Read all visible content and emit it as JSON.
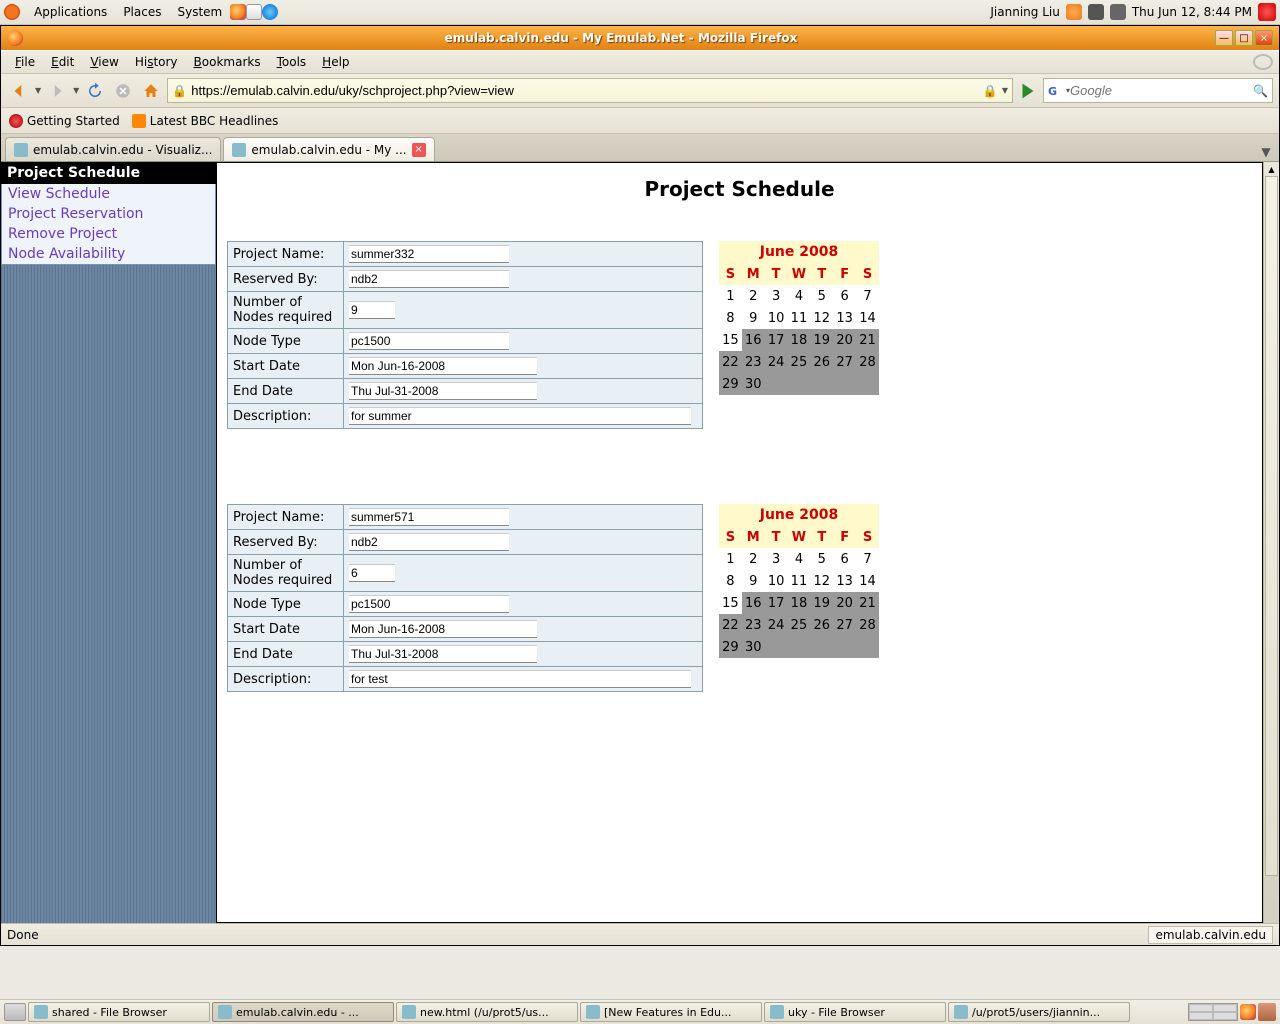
{
  "gnome": {
    "menus": {
      "applications": "Applications",
      "places": "Places",
      "system": "System"
    },
    "user": "Jianning Liu",
    "clock": "Thu Jun 12,  8:44 PM"
  },
  "firefox": {
    "title": "emulab.calvin.edu - My Emulab.Net - Mozilla Firefox",
    "menubar": {
      "file": "File",
      "edit": "Edit",
      "view": "View",
      "history": "History",
      "bookmarks": "Bookmarks",
      "tools": "Tools",
      "help": "Help"
    },
    "url": "https://emulab.calvin.edu/uky/schproject.php?view=view",
    "search_placeholder": "Google",
    "bookmarks": {
      "gs": "Getting Started",
      "bbc": "Latest BBC Headlines"
    },
    "tabs": {
      "t0": "emulab.calvin.edu - Visualiz...",
      "t1": "emulab.calvin.edu - My ..."
    },
    "status": "Done",
    "status_domain": "emulab.calvin.edu"
  },
  "sidebar": {
    "header": "Project Schedule",
    "items": {
      "view": "View Schedule",
      "res": "Project Reservation",
      "rem": "Remove Project",
      "avail": "Node Availability"
    }
  },
  "page": {
    "title": "Project Schedule",
    "labels": {
      "pname": "Project Name:",
      "rby": "Reserved By:",
      "nnodes": "Number of Nodes required",
      "ntype": "Node Type",
      "sdate": "Start Date",
      "edate": "End Date",
      "desc": "Description:"
    },
    "projects": [
      {
        "name": "summer332",
        "by": "ndb2",
        "nodes": "9",
        "type": "pc1500",
        "start": "Mon Jun-16-2008",
        "end": "Thu Jul-31-2008",
        "desc": "for summer"
      },
      {
        "name": "summer571",
        "by": "ndb2",
        "nodes": "6",
        "type": "pc1500",
        "start": "Mon Jun-16-2008",
        "end": "Thu Jul-31-2008",
        "desc": "for test"
      }
    ]
  },
  "calendar": {
    "title": "June 2008",
    "dow": {
      "s1": "S",
      "m": "M",
      "t1": "T",
      "w": "W",
      "t2": "T",
      "f": "F",
      "s2": "S"
    },
    "weeks": [
      [
        {
          "n": "1"
        },
        {
          "n": "2"
        },
        {
          "n": "3"
        },
        {
          "n": "4"
        },
        {
          "n": "5"
        },
        {
          "n": "6"
        },
        {
          "n": "7"
        }
      ],
      [
        {
          "n": "8"
        },
        {
          "n": "9"
        },
        {
          "n": "10"
        },
        {
          "n": "11"
        },
        {
          "n": "12"
        },
        {
          "n": "13"
        },
        {
          "n": "14"
        }
      ],
      [
        {
          "n": "15"
        },
        {
          "n": "16",
          "g": 1
        },
        {
          "n": "17",
          "g": 1
        },
        {
          "n": "18",
          "g": 1
        },
        {
          "n": "19",
          "g": 1
        },
        {
          "n": "20",
          "g": 1
        },
        {
          "n": "21",
          "g": 1
        }
      ],
      [
        {
          "n": "22",
          "g": 1
        },
        {
          "n": "23",
          "g": 1
        },
        {
          "n": "24",
          "g": 1
        },
        {
          "n": "25",
          "g": 1
        },
        {
          "n": "26",
          "g": 1
        },
        {
          "n": "27",
          "g": 1
        },
        {
          "n": "28",
          "g": 1
        }
      ],
      [
        {
          "n": "29",
          "g": 1
        },
        {
          "n": "30",
          "g": 1
        },
        {
          "n": "",
          "g": 1
        },
        {
          "n": "",
          "g": 1
        },
        {
          "n": "",
          "g": 1
        },
        {
          "n": "",
          "g": 1
        },
        {
          "n": "",
          "g": 1
        }
      ]
    ]
  },
  "taskbar": {
    "tasks": [
      {
        "label": "shared - File Browser"
      },
      {
        "label": "emulab.calvin.edu - ...",
        "active": true
      },
      {
        "label": "new.html (/u/prot5/us..."
      },
      {
        "label": "[New Features in Edu..."
      },
      {
        "label": "uky - File Browser"
      },
      {
        "label": "/u/prot5/users/jiannin..."
      }
    ]
  }
}
